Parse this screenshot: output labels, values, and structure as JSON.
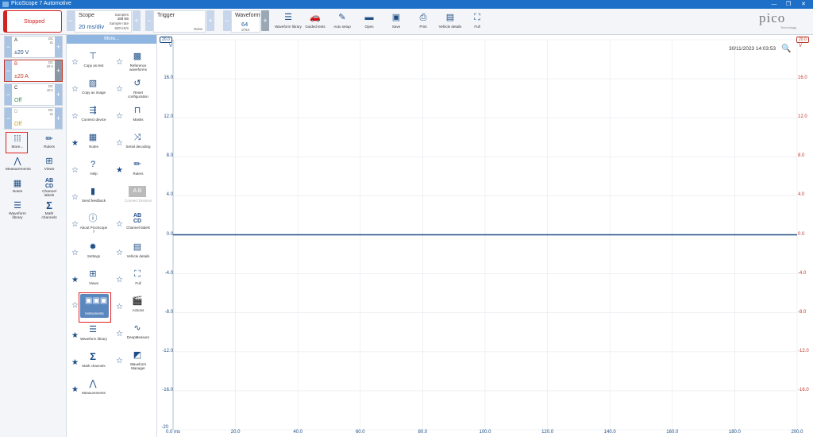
{
  "window": {
    "title": "PicoScope 7 Automotive",
    "min": "—",
    "restore": "❐",
    "close": "✕"
  },
  "toolbar": {
    "status": "Stopped",
    "scope": {
      "label": "Scope",
      "timebase": "20 ms/div",
      "samples_label": "Samples",
      "samples": "100 kS",
      "rate_label": "Sample rate",
      "rate": "500 kS/s"
    },
    "trigger": {
      "label": "Trigger",
      "mode": "None"
    },
    "waveform": {
      "label": "Waveform",
      "current": "64",
      "of": "of 64"
    },
    "buttons": [
      {
        "id": "waveform-library",
        "label": "Waveform library",
        "icon": "layers-icon"
      },
      {
        "id": "guided-tests",
        "label": "Guided tests",
        "icon": "car-icon"
      },
      {
        "id": "auto-setup",
        "label": "Auto setup",
        "icon": "wand-icon"
      },
      {
        "id": "open",
        "label": "Open",
        "icon": "folder-icon"
      },
      {
        "id": "save",
        "label": "Save",
        "icon": "save-icon"
      },
      {
        "id": "print",
        "label": "Print",
        "icon": "print-icon"
      },
      {
        "id": "vehicle-details",
        "label": "Vehicle details",
        "icon": "clipboard-icon"
      },
      {
        "id": "full",
        "label": "Full",
        "icon": "fullscreen-icon"
      }
    ],
    "logo": "pico",
    "logo_sub": "Technology"
  },
  "channels": [
    {
      "name": "A",
      "coupling": "DC",
      "probe": "x1",
      "range": "±20 V",
      "color": "#1f4e86"
    },
    {
      "name": "B",
      "coupling": "DC",
      "probe": "20 A",
      "range": "±20 A",
      "color": "#c0392b"
    },
    {
      "name": "C",
      "coupling": "DC",
      "probe": "10:1",
      "range": "Off",
      "color": "#2e8b57"
    },
    {
      "name": "D",
      "coupling": "DC",
      "probe": "x1",
      "range": "Off",
      "color": "#c9a227"
    }
  ],
  "tools": [
    {
      "label": "More...",
      "icon": "grid-icon"
    },
    {
      "label": "Rulers",
      "icon": "ruler-icon"
    },
    {
      "label": "Measurements",
      "icon": "measure-icon"
    },
    {
      "label": "Views",
      "icon": "views-icon"
    },
    {
      "label": "Notes",
      "icon": "notes-icon"
    },
    {
      "label": "Channel labels",
      "icon": "abcd-icon"
    },
    {
      "label": "Waveform library",
      "icon": "layers-icon"
    },
    {
      "label": "Math channels",
      "icon": "sigma-icon"
    }
  ],
  "more_panel": {
    "header": "More...",
    "left": [
      {
        "label": "Copy as text",
        "icon": "copy-text-icon",
        "fav": false
      },
      {
        "label": "Copy as image",
        "icon": "copy-image-icon",
        "fav": false
      },
      {
        "label": "Connect device",
        "icon": "usb-icon",
        "fav": false
      },
      {
        "label": "Notes",
        "icon": "notes-icon",
        "fav": true
      },
      {
        "label": "Help",
        "icon": "help-icon",
        "fav": false
      },
      {
        "label": "Send feedback",
        "icon": "feedback-icon",
        "fav": false
      },
      {
        "label": "About PicoScope 7",
        "icon": "info-icon",
        "fav": false
      },
      {
        "label": "Settings",
        "icon": "settings-icon",
        "fav": false
      },
      {
        "label": "Views",
        "icon": "views-icon",
        "fav": true
      },
      {
        "label": "Instruments",
        "icon": "instruments-icon",
        "fav": false
      },
      {
        "label": "Waveform library",
        "icon": "layers-icon",
        "fav": true
      },
      {
        "label": "Math channels",
        "icon": "sigma-icon",
        "fav": true
      },
      {
        "label": "Measurements",
        "icon": "measure-icon",
        "fav": true
      }
    ],
    "right": [
      {
        "label": "Reference waveforms",
        "icon": "reference-icon",
        "fav": false
      },
      {
        "label": "Reset configuration",
        "icon": "reset-icon",
        "fav": false
      },
      {
        "label": "Masks",
        "icon": "masks-icon",
        "fav": false
      },
      {
        "label": "Serial decoding",
        "icon": "serial-icon",
        "fav": false
      },
      {
        "label": "Rulers",
        "icon": "ruler-icon",
        "fav": true
      },
      {
        "label": "Channel labels",
        "icon": "abcd-icon",
        "fav": false
      },
      {
        "label": "Vehicle details",
        "icon": "clipboard-icon",
        "fav": false
      },
      {
        "label": "Full",
        "icon": "fullscreen-icon",
        "fav": false
      },
      {
        "label": "Actions",
        "icon": "actions-icon",
        "fav": false
      },
      {
        "label": "DeepMeasure",
        "icon": "deepmeasure-icon",
        "fav": false
      },
      {
        "label": "Waveform Manager",
        "icon": "manager-icon",
        "fav": false
      }
    ],
    "greyed": {
      "label": "Connect Devices",
      "icon": "ab-icon"
    }
  },
  "scope_view": {
    "timestamp": "30/11/2023 14:03:53",
    "left_unit": "V",
    "right_unit": "V",
    "left_marker": "20.0",
    "right_marker": "20.0",
    "bottom_left": "-20",
    "y_ticks": [
      "16.0",
      "12.0",
      "8.0",
      "4.0",
      "0.0",
      "-4.0",
      "-8.0",
      "-12.0",
      "-16.0"
    ],
    "x_ticks": [
      "0.0 ms",
      "20.0",
      "40.0",
      "60.0",
      "80.0",
      "100.0",
      "120.0",
      "140.0",
      "160.0",
      "180.0",
      "200.0"
    ]
  },
  "chart_data": {
    "type": "line",
    "x": [
      0,
      200
    ],
    "series": [
      {
        "values": [
          0,
          0
        ],
        "color": "#1f4e86"
      }
    ],
    "xlabel": "ms",
    "ylabel": "V",
    "xlim": [
      0,
      200
    ],
    "ylim": [
      -20,
      20
    ],
    "grid": true,
    "colors": {
      "channel_a": "#1f4e86",
      "channel_b": "#c0392b"
    }
  }
}
